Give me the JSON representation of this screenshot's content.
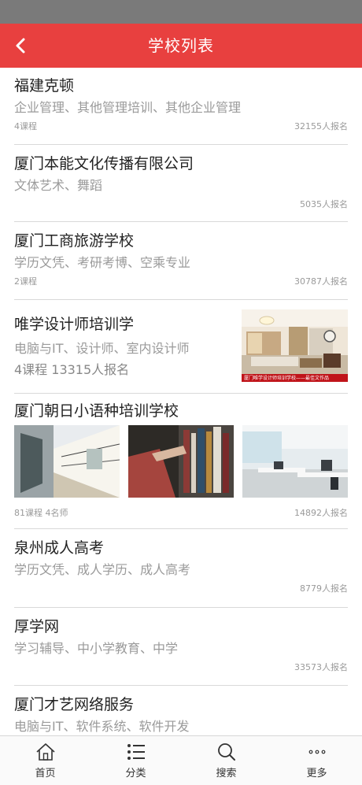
{
  "header": {
    "title": "学校列表"
  },
  "schools": [
    {
      "name": "福建克顿",
      "tags": "企业管理、其他管理培训、其他企业管理",
      "courses": "4课程",
      "enrolled": "32155人报名"
    },
    {
      "name": "厦门本能文化传播有限公司",
      "tags": "文体艺术、舞蹈",
      "enrolled": "5035人报名"
    },
    {
      "name": "厦门工商旅游学校",
      "tags": "学历文凭、考研考博、空乘专业",
      "courses": "2课程",
      "enrolled": "30787人报名"
    },
    {
      "name": "唯学设计师培训学",
      "tags": "电脑与IT、设计师、室内设计师",
      "stats": "4课程 13315人报名",
      "image_caption": "厦门唯学设计师培训学校——最佳文作品"
    },
    {
      "name": "厦门朝日小语种培训学校",
      "meta_left": "81课程  4名师",
      "enrolled": "14892人报名"
    },
    {
      "name": "泉州成人高考",
      "tags": "学历文凭、成人学历、成人高考",
      "enrolled": "8779人报名"
    },
    {
      "name": "厚学网",
      "tags": "学习辅导、中小学教育、中学",
      "enrolled": "33573人报名"
    },
    {
      "name": "厦门才艺网络服务",
      "tags": "电脑与IT、软件系统、软件开发"
    }
  ],
  "tabs": [
    {
      "label": "首页",
      "icon": "home-icon"
    },
    {
      "label": "分类",
      "icon": "list-icon"
    },
    {
      "label": "搜索",
      "icon": "search-icon"
    },
    {
      "label": "更多",
      "icon": "more-icon"
    }
  ],
  "colors": {
    "header": "#e8403f",
    "status_bar": "#7a7a7a",
    "muted_text": "#9a9a9a"
  }
}
